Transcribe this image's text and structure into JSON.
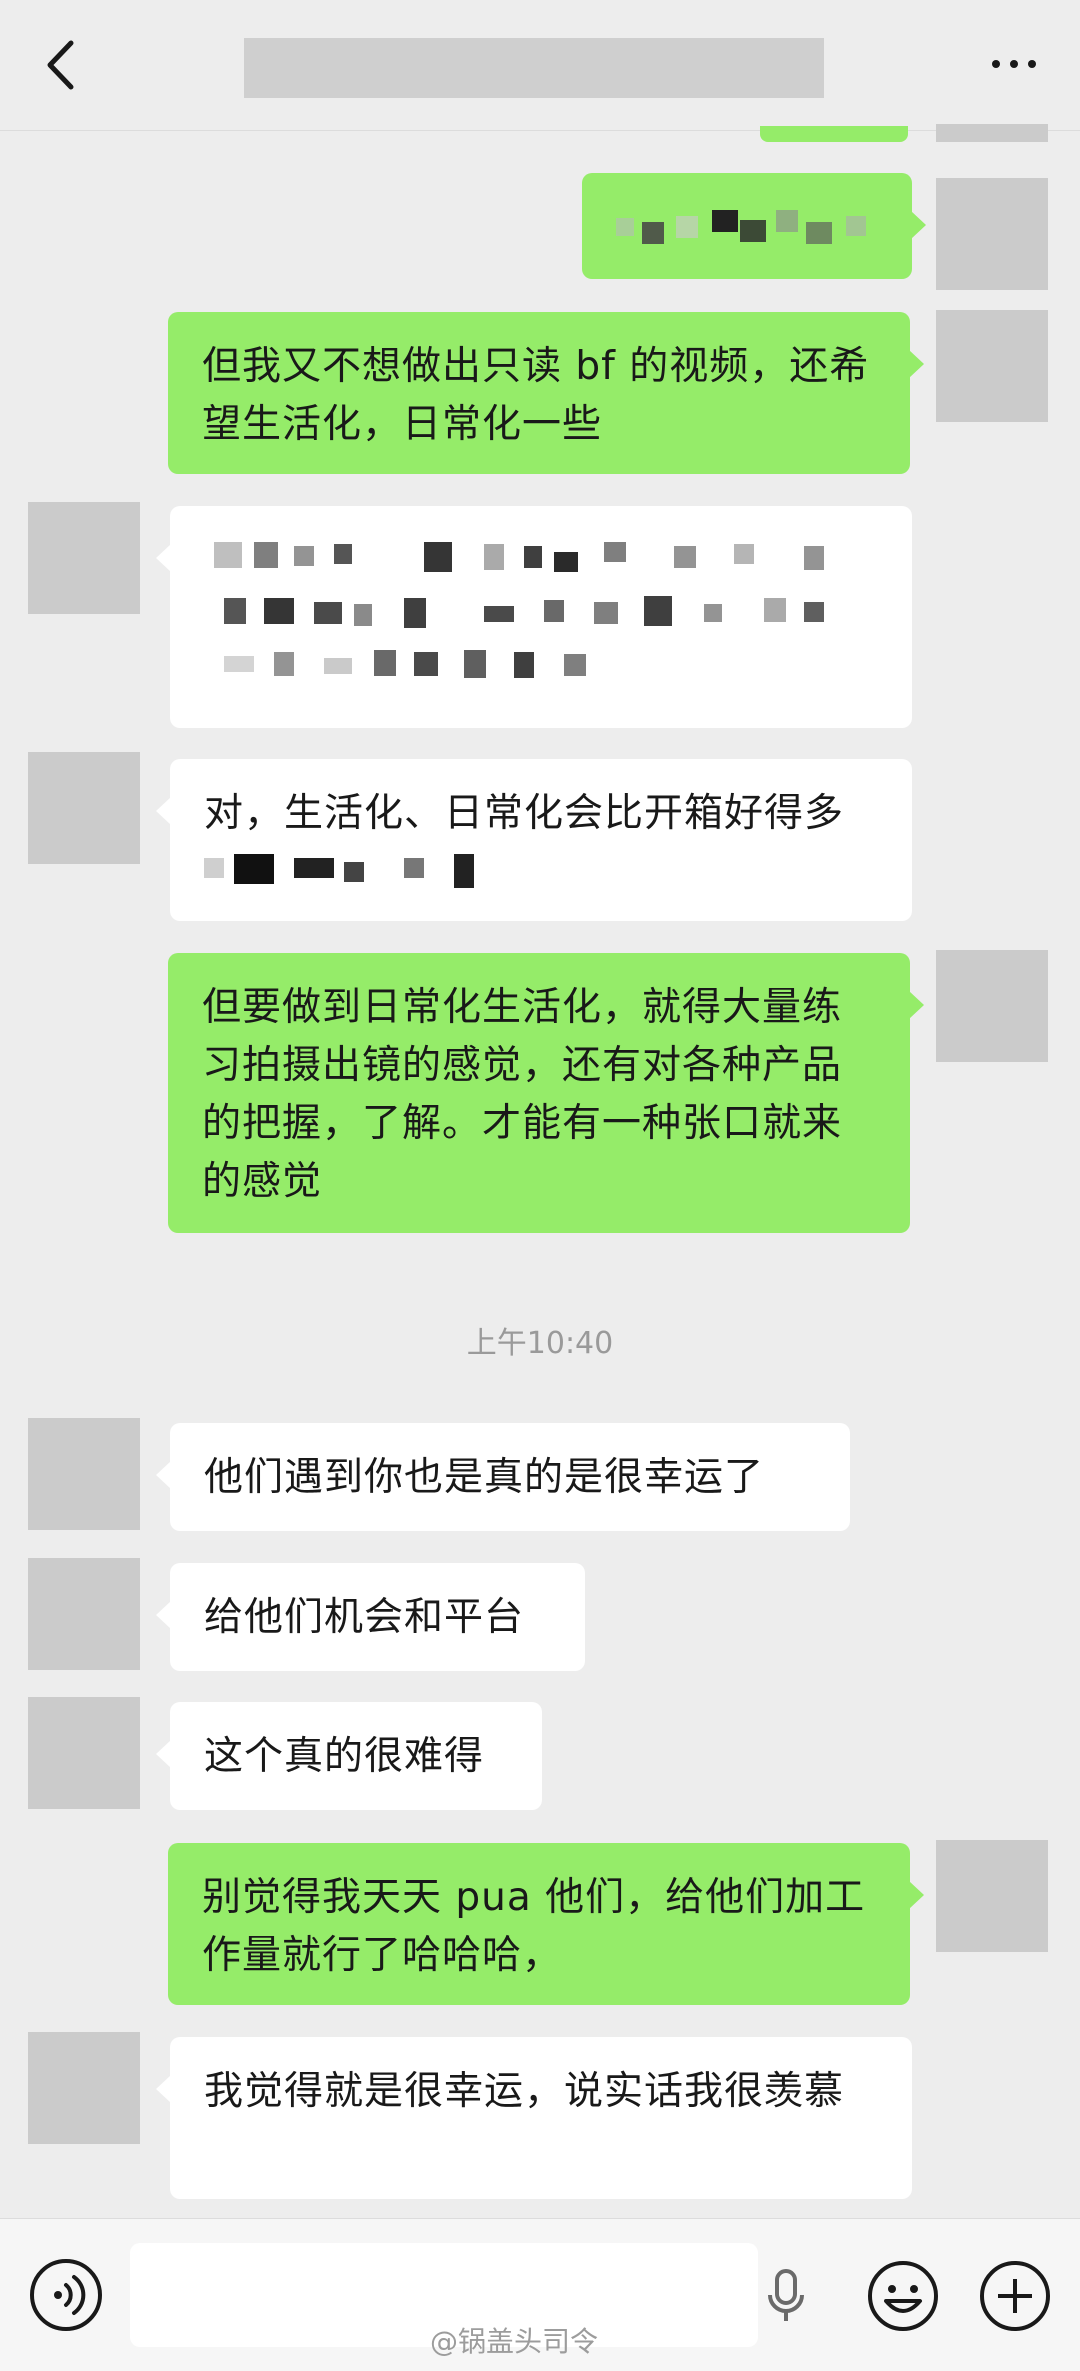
{
  "header": {
    "back_icon": "chevron-left-icon",
    "more_icon": "more-dots-icon"
  },
  "messages": [
    {
      "side": "right",
      "text": "但我又不想做出只读 bf 的视频，还希望生活化，日常化一些"
    },
    {
      "side": "left",
      "text": "对，生活化、日常化会比开箱好得多"
    },
    {
      "side": "right",
      "text": "但要做到日常化生活化，就得大量练习拍摄出镜的感觉，还有对各种产品的把握，了解。才能有一种张口就来的感觉"
    },
    {
      "side": "left",
      "text": "他们遇到你也是真的是很幸运了"
    },
    {
      "side": "left",
      "text": "给他们机会和平台"
    },
    {
      "side": "left",
      "text": "这个真的很难得"
    },
    {
      "side": "right",
      "text": "别觉得我天天 pua 他们，给他们加工作量就行了哈哈哈，"
    },
    {
      "side": "left",
      "text": "我觉得就是很幸运，说实话我很羡慕"
    }
  ],
  "timestamp": "上午10:40",
  "input_bar": {
    "placeholder": ""
  },
  "watermark": "@锅盖头司令",
  "colors": {
    "background": "#ededed",
    "sent_bubble": "#95ec69",
    "received_bubble": "#ffffff",
    "avatar_placeholder": "#cbcbcb"
  }
}
